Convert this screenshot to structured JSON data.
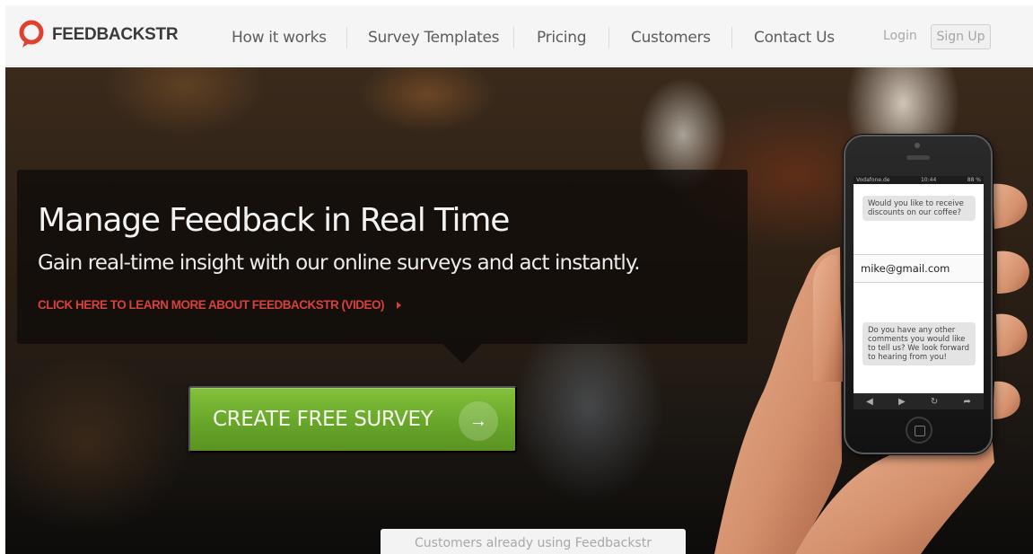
{
  "brand": {
    "name": "FEEDBACKSTR",
    "accent": "#e0412e"
  },
  "nav": {
    "items": [
      {
        "label": "How it works"
      },
      {
        "label": "Survey Templates"
      },
      {
        "label": "Pricing"
      },
      {
        "label": "Customers"
      },
      {
        "label": "Contact Us"
      }
    ],
    "login_label": "Login",
    "signup_label": "Sign Up"
  },
  "hero": {
    "headline": "Manage Feedback in Real Time",
    "subheadline": "Gain real-time insight with our online surveys and act instantly.",
    "video_link": "CLICK HERE TO LEARN MORE ABOUT FEEDBACKSTR (VIDEO)",
    "cta_label": "CREATE FREE SURVEY",
    "cta_icon": "arrow-right-icon",
    "cta_color": "#6cae2c",
    "customers_tab": "Customers already using Feedbackstr"
  },
  "phone": {
    "status_carrier": "Vodafone.de",
    "status_time": "10:44",
    "status_battery": "88 %",
    "question_1": "Would you like to receive discounts on our coffee?",
    "answer_email": "mike@gmail.com",
    "question_2": "Do you have any other comments you would like to tell us? We look forward to hearing from you!"
  }
}
